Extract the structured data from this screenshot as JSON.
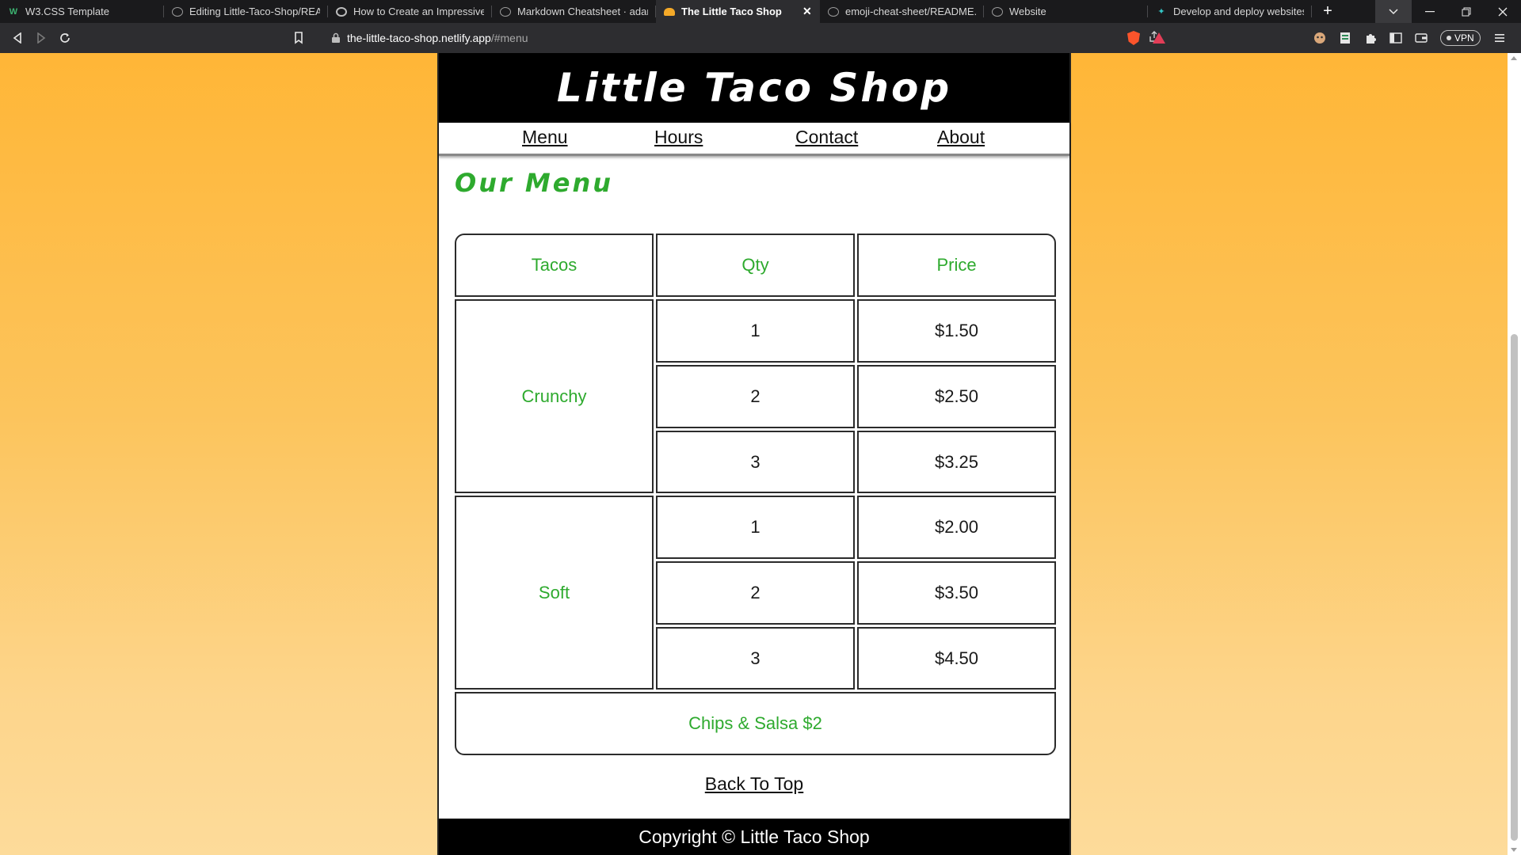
{
  "browser": {
    "tabs": [
      {
        "title": "W3.CSS Template",
        "icon": "w3-icon",
        "active": false
      },
      {
        "title": "Editing Little-Taco-Shop/README",
        "icon": "github-icon",
        "active": false
      },
      {
        "title": "How to Create an Impressive GitHub",
        "icon": "site-icon",
        "active": false
      },
      {
        "title": "Markdown Cheatsheet · adam-p",
        "icon": "github-icon",
        "active": false
      },
      {
        "title": "The Little Taco Shop",
        "icon": "taco-icon",
        "active": true
      },
      {
        "title": "emoji-cheat-sheet/README.md",
        "icon": "github-icon",
        "active": false
      },
      {
        "title": "Website",
        "icon": "globe-icon",
        "active": false
      },
      {
        "title": "Develop and deploy websites a",
        "icon": "netlify-icon",
        "active": false
      }
    ],
    "url": {
      "host": "the-little-taco-shop.netlify.app",
      "path": "/#menu"
    },
    "vpn_label": "VPN"
  },
  "site": {
    "title": "Little Taco Shop",
    "nav": [
      "Menu",
      "Hours",
      "Contact",
      "About"
    ],
    "menu_heading": "Our Menu",
    "table": {
      "headers": [
        "Tacos",
        "Qty",
        "Price"
      ],
      "groups": [
        {
          "name": "Crunchy",
          "rows": [
            {
              "qty": "1",
              "price": "$1.50"
            },
            {
              "qty": "2",
              "price": "$2.50"
            },
            {
              "qty": "3",
              "price": "$3.25"
            }
          ]
        },
        {
          "name": "Soft",
          "rows": [
            {
              "qty": "1",
              "price": "$2.00"
            },
            {
              "qty": "2",
              "price": "$3.50"
            },
            {
              "qty": "3",
              "price": "$4.50"
            }
          ]
        }
      ],
      "footer": "Chips & Salsa $2"
    },
    "back_to_top": "Back To Top",
    "copyright": "Copyright © Little Taco Shop"
  },
  "colors": {
    "accent_green": "#2eaa2e",
    "page_background_top": "#ffb637",
    "page_background_bottom": "#fddb9a"
  }
}
